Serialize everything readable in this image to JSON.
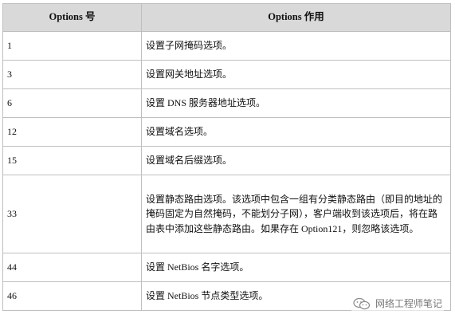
{
  "table": {
    "header": {
      "col1": "Options 号",
      "col2": "Options 作用"
    },
    "rows": [
      {
        "num": "1",
        "desc": "设置子网掩码选项。"
      },
      {
        "num": "3",
        "desc": "设置网关地址选项。"
      },
      {
        "num": "6",
        "desc": "设置 DNS 服务器地址选项。"
      },
      {
        "num": "12",
        "desc": "设置域名选项。"
      },
      {
        "num": "15",
        "desc": "设置域名后缀选项。"
      },
      {
        "num": "33",
        "desc": "设置静态路由选项。该选项中包含一组有分类静态路由（即目的地址的掩码固定为自然掩码，不能划分子网），客户端收到该选项后，将在路由表中添加这些静态路由。如果存在 Option121，则忽略该选项。"
      },
      {
        "num": "44",
        "desc": "设置 NetBios 名字选项。"
      },
      {
        "num": "46",
        "desc": "设置 NetBios 节点类型选项。"
      }
    ]
  },
  "watermark": {
    "text": "网络工程师笔记",
    "icon": "wechat-icon"
  }
}
